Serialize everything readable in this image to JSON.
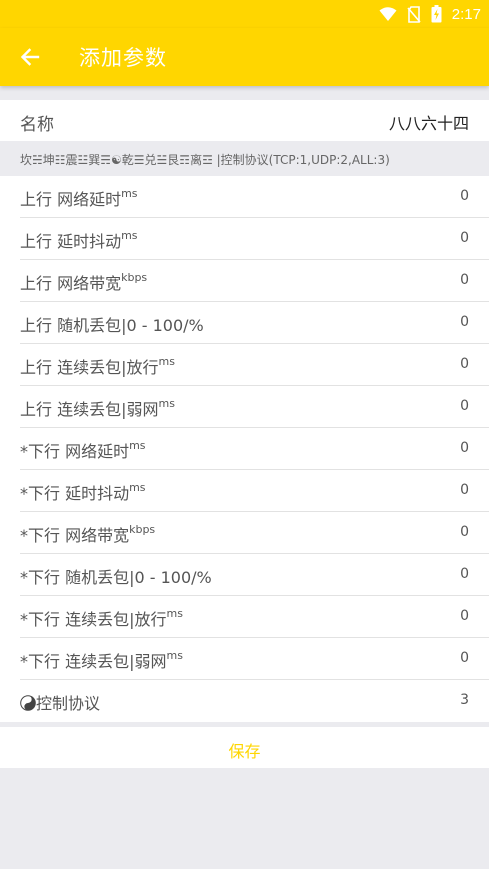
{
  "status_bar": {
    "time": "2:17"
  },
  "app_bar": {
    "title": "添加参数"
  },
  "name_row": {
    "label": "名称",
    "value": "八八六十四"
  },
  "hint": "坎☵坤☷震☳巽☴☯乾☰兑☱艮☶离☲ |控制协议(TCP:1,UDP:2,ALL:3)",
  "params": [
    {
      "label": "上行 网络延时",
      "unit": "ms",
      "value": "0"
    },
    {
      "label": "上行 延时抖动",
      "unit": "ms",
      "value": "0"
    },
    {
      "label": "上行 网络带宽",
      "unit": "kbps",
      "value": "0"
    },
    {
      "label": "上行 随机丢包|0 - 100/%",
      "unit": "",
      "value": "0"
    },
    {
      "label": "上行 连续丢包|放行",
      "unit": "ms",
      "value": "0"
    },
    {
      "label": "上行 连续丢包|弱网",
      "unit": "ms",
      "value": "0"
    },
    {
      "label": "*下行 网络延时",
      "unit": "ms",
      "value": "0"
    },
    {
      "label": "*下行 延时抖动",
      "unit": "ms",
      "value": "0"
    },
    {
      "label": "*下行 网络带宽",
      "unit": "kbps",
      "value": "0"
    },
    {
      "label": "*下行 随机丢包|0 - 100/%",
      "unit": "",
      "value": "0"
    },
    {
      "label": "*下行 连续丢包|放行",
      "unit": "ms",
      "value": "0"
    },
    {
      "label": "*下行 连续丢包|弱网",
      "unit": "ms",
      "value": "0"
    },
    {
      "label": "控制协议",
      "unit": "",
      "value": "3",
      "icon": "yin-yang-icon"
    }
  ],
  "save_button": {
    "label": "保存"
  },
  "colors": {
    "accent": "#ffd600",
    "background": "#ebebef",
    "divider": "#e2e2e2"
  }
}
